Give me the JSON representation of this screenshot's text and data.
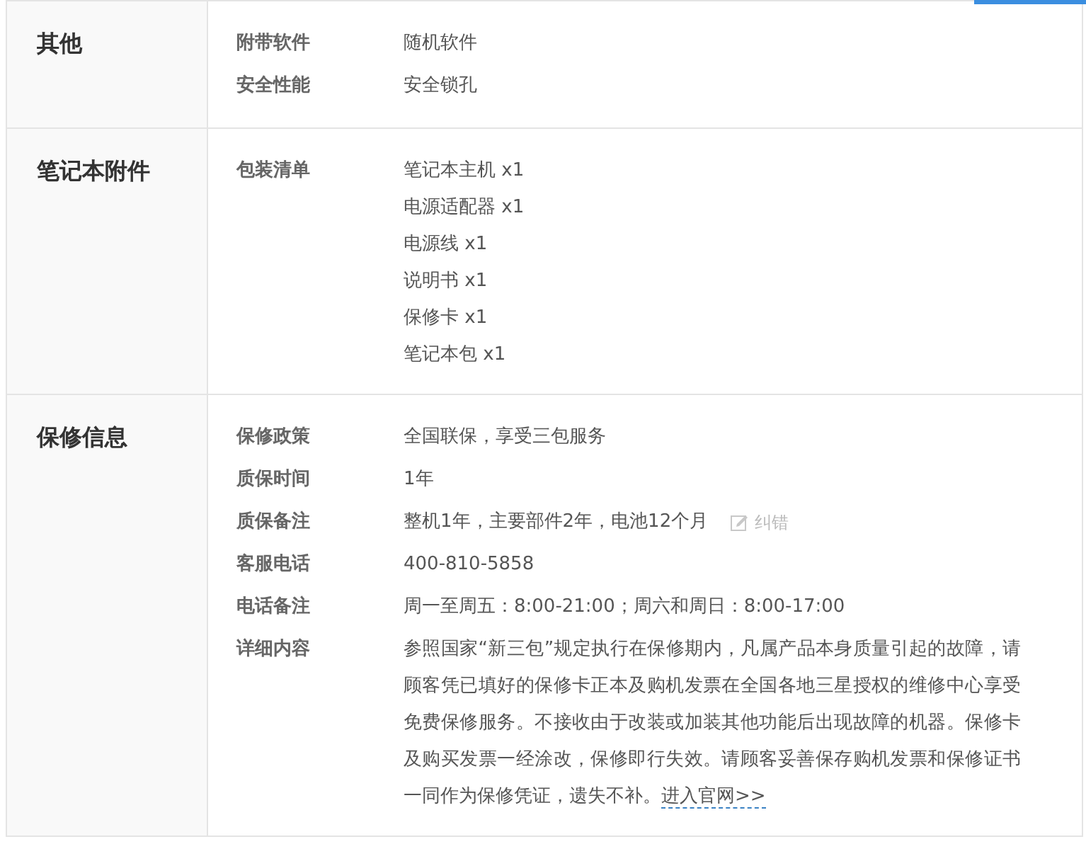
{
  "sections": [
    {
      "title": "其他",
      "rows": [
        {
          "kind": "text",
          "label": "附带软件",
          "value": "随机软件"
        },
        {
          "kind": "text",
          "label": "安全性能",
          "value": "安全锁孔"
        }
      ]
    },
    {
      "title": "笔记本附件",
      "rows": [
        {
          "kind": "list",
          "label": "包装清单",
          "items": [
            "笔记本主机 x1",
            "电源适配器 x1",
            "电源线 x1",
            "说明书 x1",
            "保修卡 x1",
            "笔记本包 x1"
          ]
        }
      ]
    },
    {
      "title": "保修信息",
      "rows": [
        {
          "kind": "text",
          "label": "保修政策",
          "value": "全国联保，享受三包服务"
        },
        {
          "kind": "text",
          "label": "质保时间",
          "value": "1年"
        },
        {
          "kind": "correctable",
          "label": "质保备注",
          "value": "整机1年，主要部件2年，电池12个月",
          "action": "纠错"
        },
        {
          "kind": "text",
          "label": "客服电话",
          "value": "400-810-5858"
        },
        {
          "kind": "text",
          "label": "电话备注",
          "value": "周一至周五：8:00-21:00；周六和周日：8:00-17:00"
        },
        {
          "kind": "paragraph",
          "label": "详细内容",
          "value": "参照国家“新三包”规定执行在保修期内，凡属产品本身质量引起的故障，请顾客凭已填好的保修卡正本及购机发票在全国各地三星授权的维修中心享受免费保修服务。不接收由于改装或加装其他功能后出现故障的机器。保修卡及购买发票一经涂改，保修即行失效。请顾客妥善保存购机发票和保修证书一同作为保修凭证，遗失不补。",
          "link": "进入官网>>"
        }
      ]
    }
  ]
}
